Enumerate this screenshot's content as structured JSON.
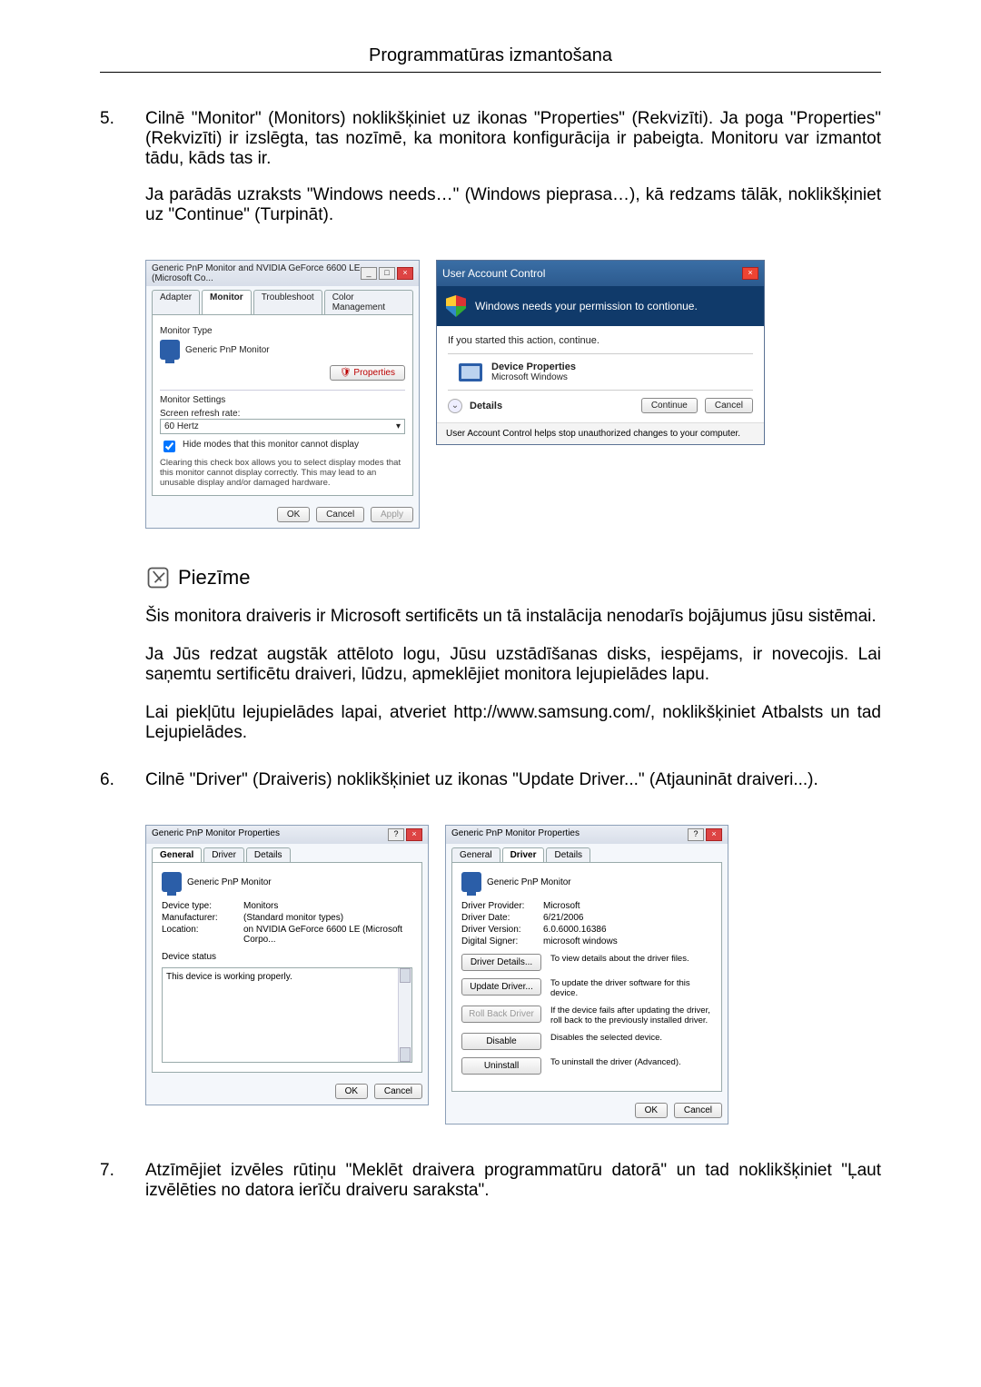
{
  "header_title": "Programmatūras izmantošana",
  "step5_num": "5.",
  "step5_p1": "Cilnē \"Monitor\" (Monitors) noklikšķiniet uz ikonas \"Properties\" (Rekvizīti). Ja poga \"Properties\" (Rekvizīti) ir izslēgta, tas nozīmē, ka monitora konfigurācija ir pabeigta. Monitoru var izmantot tādu, kāds tas ir.",
  "step5_p2": "Ja parādās uzraksts \"Windows needs…\" (Windows pieprasa…), kā redzams tālāk, noklikšķiniet uz \"Continue\" (Turpināt).",
  "dlgA": {
    "title": "Generic PnP Monitor and NVIDIA GeForce 6600 LE (Microsoft Co...",
    "tab_adapter": "Adapter",
    "tab_monitor": "Monitor",
    "tab_troubleshoot": "Troubleshoot",
    "tab_color": "Color Management",
    "grp_type": "Monitor Type",
    "monitor_name": "Generic PnP Monitor",
    "btn_properties": "Properties",
    "grp_settings": "Monitor Settings",
    "lbl_refresh": "Screen refresh rate:",
    "val_refresh": "60 Hertz",
    "chk_hide": "Hide modes that this monitor cannot display",
    "chk_note": "Clearing this check box allows you to select display modes that this monitor cannot display correctly. This may lead to an unusable display and/or damaged hardware.",
    "btn_ok": "OK",
    "btn_cancel": "Cancel",
    "btn_apply": "Apply"
  },
  "uac": {
    "title": "User Account Control",
    "banner": "Windows needs your permission to contionue.",
    "line": "If you started this action, continue.",
    "prog_name": "Device Properties",
    "prog_pub": "Microsoft Windows",
    "details": "Details",
    "btn_continue": "Continue",
    "btn_cancel": "Cancel",
    "foot": "User Account Control helps stop unauthorized changes to your computer."
  },
  "note": {
    "label": "Piezīme",
    "p1": "Šis monitora draiveris ir Microsoft sertificēts un tā instalācija nenodarīs bojājumus jūsu sistēmai.",
    "p2": "Ja Jūs redzat augstāk attēloto logu, Jūsu uzstādīšanas disks, iespējams, ir novecojis. Lai saņemtu sertificētu draiveri, lūdzu, apmeklējiet monitora lejupielādes lapu.",
    "p3": "Lai piekļūtu lejupielādes lapai, atveriet http://www.samsung.com/, noklikšķiniet Atbalsts un tad Lejupielādes."
  },
  "step6_num": "6.",
  "step6_p1": "Cilnē \"Driver\" (Draiveris) noklikšķiniet uz ikonas \"Update Driver...\" (Atjaunināt draiveri...).",
  "dlgGen": {
    "title": "Generic PnP Monitor Properties",
    "tab_general": "General",
    "tab_driver": "Driver",
    "tab_details": "Details",
    "monitor_name": "Generic PnP Monitor",
    "k_type": "Device type:",
    "v_type": "Monitors",
    "k_manu": "Manufacturer:",
    "v_manu": "(Standard monitor types)",
    "k_loc": "Location:",
    "v_loc": "on NVIDIA GeForce 6600 LE (Microsoft Corpo...",
    "grp_status": "Device status",
    "status_text": "This device is working properly.",
    "btn_ok": "OK",
    "btn_cancel": "Cancel"
  },
  "dlgDrv": {
    "title": "Generic PnP Monitor Properties",
    "monitor_name": "Generic PnP Monitor",
    "k_prov": "Driver Provider:",
    "v_prov": "Microsoft",
    "k_date": "Driver Date:",
    "v_date": "6/21/2006",
    "k_ver": "Driver Version:",
    "v_ver": "6.0.6000.16386",
    "k_sign": "Digital Signer:",
    "v_sign": "microsoft windows",
    "btn_details": "Driver Details...",
    "txt_details": "To view details about the driver files.",
    "btn_update": "Update Driver...",
    "txt_update": "To update the driver software for this device.",
    "btn_rollback": "Roll Back Driver",
    "txt_rollback": "If the device fails after updating the driver, roll back to the previously installed driver.",
    "btn_disable": "Disable",
    "txt_disable": "Disables the selected device.",
    "btn_uninstall": "Uninstall",
    "txt_uninstall": "To uninstall the driver (Advanced).",
    "btn_ok": "OK",
    "btn_cancel": "Cancel"
  },
  "step7_num": "7.",
  "step7_p1": "Atzīmējiet izvēles rūtiņu \"Meklēt draivera programmatūru datorā\" un tad noklikšķiniet \"Ļaut izvēlēties no datora ierīču draiveru saraksta\"."
}
